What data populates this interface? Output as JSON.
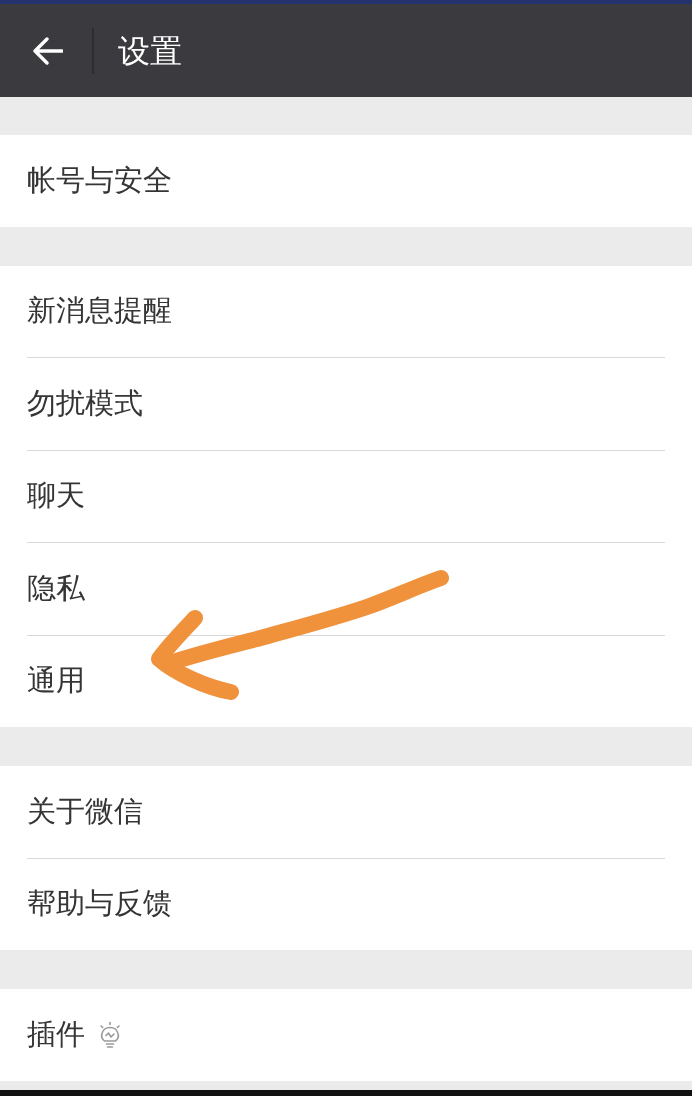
{
  "header": {
    "title": "设置"
  },
  "groups": [
    {
      "items": [
        {
          "label": "帐号与安全",
          "kind": "plain"
        }
      ]
    },
    {
      "items": [
        {
          "label": "新消息提醒",
          "kind": "plain"
        },
        {
          "label": "勿扰模式",
          "kind": "plain"
        },
        {
          "label": "聊天",
          "kind": "plain"
        },
        {
          "label": "隐私",
          "kind": "plain"
        },
        {
          "label": "通用",
          "kind": "plain"
        }
      ]
    },
    {
      "items": [
        {
          "label": "关于微信",
          "kind": "plain"
        },
        {
          "label": "帮助与反馈",
          "kind": "plain"
        }
      ]
    },
    {
      "items": [
        {
          "label": "插件",
          "kind": "bulb"
        }
      ]
    }
  ]
}
